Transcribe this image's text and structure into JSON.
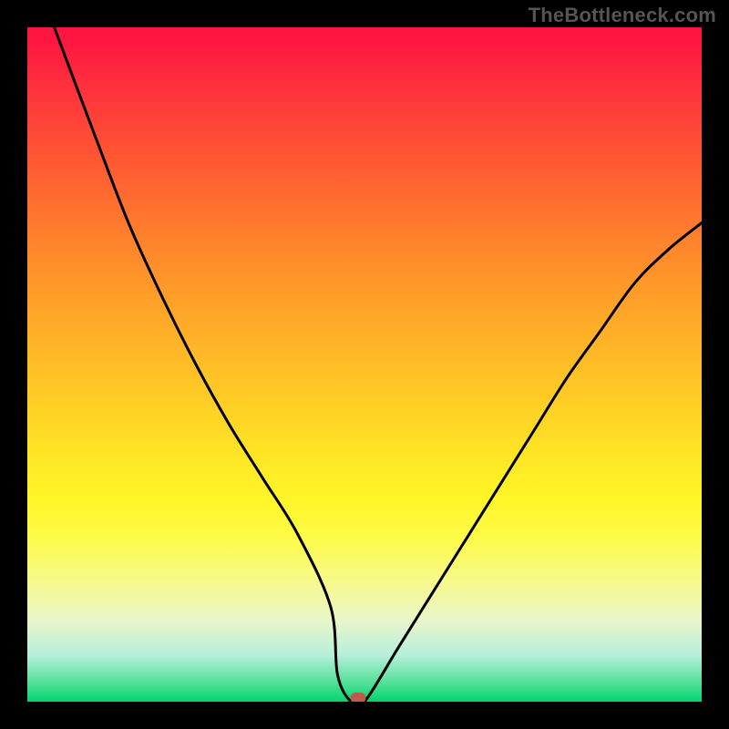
{
  "watermark": "TheBottleneck.com",
  "chart_data": {
    "type": "line",
    "title": "",
    "xlabel": "",
    "ylabel": "",
    "xlim": [
      0,
      100
    ],
    "ylim": [
      0,
      100
    ],
    "x": [
      4,
      10,
      15,
      20,
      25,
      30,
      35,
      40,
      45,
      46,
      48,
      50,
      55,
      60,
      65,
      70,
      75,
      80,
      85,
      90,
      95,
      100
    ],
    "y": [
      100,
      84,
      71,
      60,
      50,
      41,
      33,
      25,
      14,
      4,
      0,
      0,
      8,
      16,
      24,
      32,
      40,
      48,
      55,
      62,
      67,
      71
    ],
    "marker": {
      "x": 49,
      "y": 0.5
    },
    "gradient_theme": "green-to-red"
  }
}
